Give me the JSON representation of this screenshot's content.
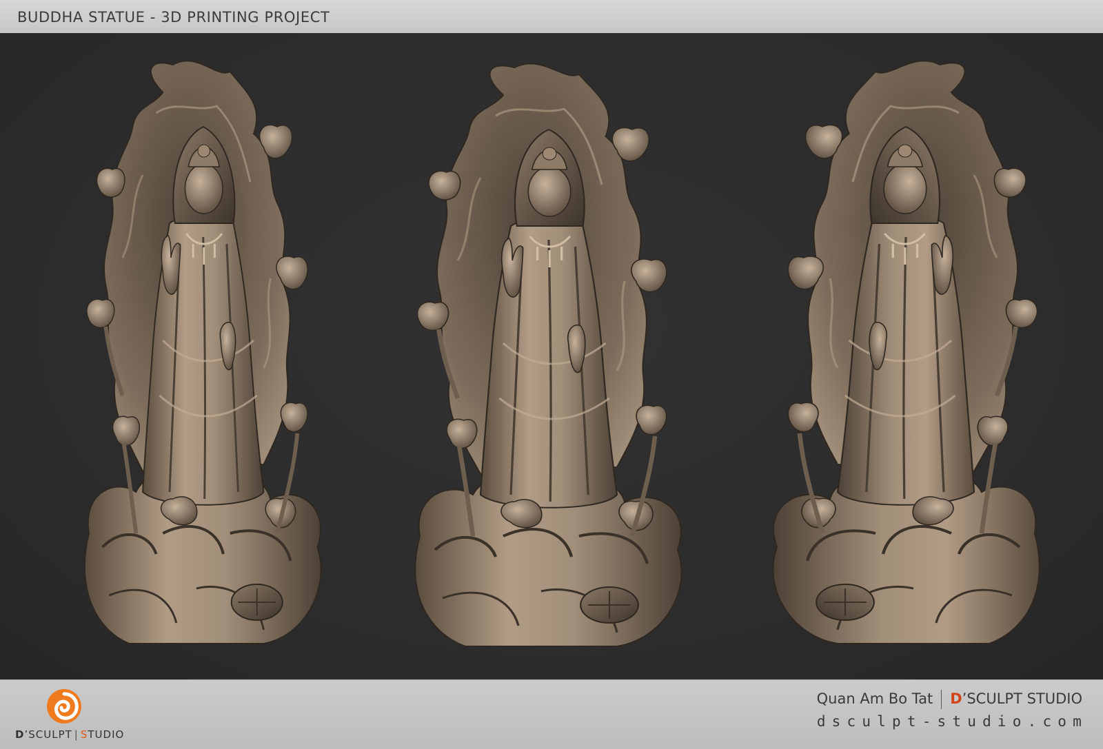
{
  "header": {
    "title": "BUDDHA STATUE - 3D PRINTING PROJECT"
  },
  "viewport": {
    "background_color": "#2c2c2d",
    "material_color": "#a18e79",
    "views": [
      {
        "name": "statue-view-left",
        "angle": "three-quarter left"
      },
      {
        "name": "statue-view-front",
        "angle": "front"
      },
      {
        "name": "statue-view-right",
        "angle": "three-quarter right"
      }
    ]
  },
  "footer": {
    "logo": {
      "brand_first": "D",
      "apostrophe": "’",
      "brand_rest": "SCULPT",
      "separator": "|",
      "studio_first": "S",
      "studio_rest": "TUDIO",
      "accent_color": "#f07a1e"
    },
    "credits": {
      "subject": "Quan Am Bo Tat",
      "studio_first": "D",
      "studio_rest": "’SCULPT STUDIO",
      "website": "dsculpt-studio.com"
    }
  }
}
